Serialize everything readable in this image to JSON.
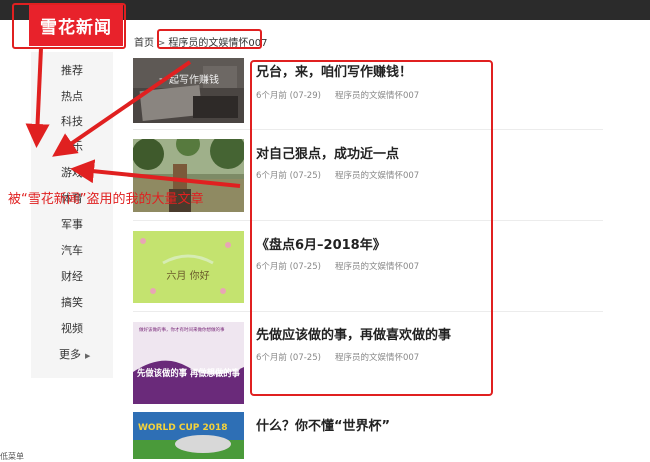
{
  "brand": {
    "logo_text": "雪花新闻"
  },
  "breadcrumb": {
    "home": "首页",
    "separator": ">",
    "current": "程序员的文娱情怀007"
  },
  "sidebar": {
    "items": [
      {
        "label": "推荐"
      },
      {
        "label": "热点"
      },
      {
        "label": "科技"
      },
      {
        "label": "娱乐"
      },
      {
        "label": "游戏"
      },
      {
        "label": "体育"
      },
      {
        "label": "军事"
      },
      {
        "label": "汽车"
      },
      {
        "label": "财经"
      },
      {
        "label": "搞笑"
      },
      {
        "label": "视频"
      }
    ],
    "more_label": "更多"
  },
  "articles": [
    {
      "title": "兄台，来，咱们写作赚钱！",
      "time": "6个月前 (07-29)",
      "author": "程序员的文娱情怀007",
      "thumb_text": "一起写作赚钱"
    },
    {
      "title": "对自己狠点，成功近一点",
      "time": "6个月前 (07-25)",
      "author": "程序员的文娱情怀007",
      "thumb_text": ""
    },
    {
      "title": "《盘点6月–2018年》",
      "time": "6个月前 (07-25)",
      "author": "程序员的文娱情怀007",
      "thumb_text": "六月 你好"
    },
    {
      "title": "先做应该做的事，再做喜欢做的事",
      "time": "6个月前 (07-25)",
      "author": "程序员的文娱情怀007",
      "thumb_text": "先做该做的事 再做想做的事",
      "thumb_small": "做好该做的事，你才有时间来做你想做的事"
    },
    {
      "title": "什么？你不懂“世界杯”",
      "time": "",
      "author": "",
      "thumb_text": "WORLD CUP 2018"
    }
  ],
  "annotation": {
    "text": "被“雪花新闻”盗用的我的大量文章"
  },
  "bottom_cut": "低菜单",
  "colors": {
    "brand_red": "#e8222b",
    "annotation_red": "#e02020",
    "topbar": "#2b2b2b",
    "sidebar_bg": "#f5f5f5"
  }
}
